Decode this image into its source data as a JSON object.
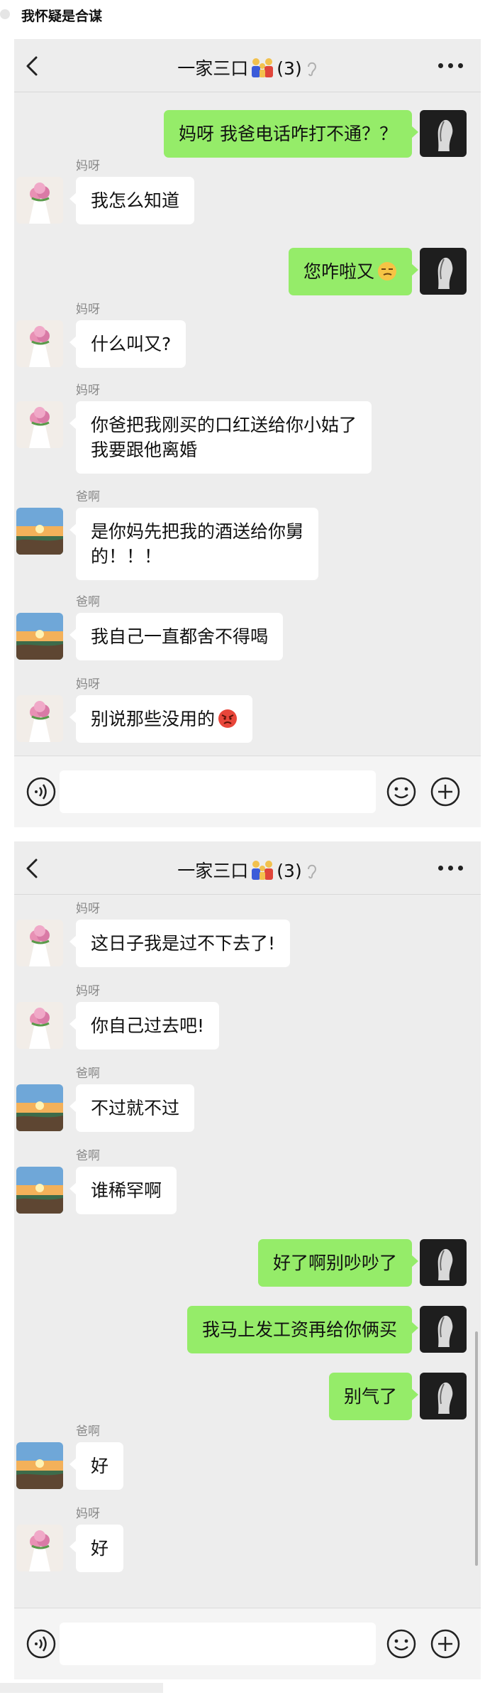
{
  "post": {
    "title": "我怀疑是合谋"
  },
  "chat": {
    "title": "一家三口",
    "member_count": "(3)",
    "title_emoji": "family-emoji",
    "muted_icon": "ear-icon",
    "colors": {
      "background": "#ededed",
      "self_bubble": "#95ec69",
      "other_bubble": "#ffffff",
      "sender_name": "#8a8a8a"
    }
  },
  "screens": [
    {
      "messages": [
        {
          "side": "right",
          "text": "妈呀 我爸电话咋打不通？？"
        },
        {
          "side": "left",
          "sender": "妈呀",
          "text": "我怎么知道"
        },
        {
          "side": "right",
          "text": "您咋啦又",
          "emoji": "smirk-face-icon"
        },
        {
          "side": "left",
          "sender": "妈呀",
          "text": "什么叫又?"
        },
        {
          "side": "left",
          "sender": "妈呀",
          "lines": [
            "你爸把我刚买的口红送给你小姑了",
            " 我要跟他离婚"
          ]
        },
        {
          "side": "left",
          "sender": "爸啊",
          "lines": [
            "是你妈先把我的酒送给你舅",
            "的！！！"
          ]
        },
        {
          "side": "left",
          "sender": "爸啊",
          "text": "我自己一直都舍不得喝"
        },
        {
          "side": "left",
          "sender": "妈呀",
          "text": "别说那些没用的",
          "emoji": "angry-face-icon"
        }
      ]
    },
    {
      "messages": [
        {
          "side": "left",
          "sender": "妈呀",
          "text": "这日子我是过不下去了!"
        },
        {
          "side": "left",
          "sender": "妈呀",
          "text": "你自己过去吧!"
        },
        {
          "side": "left",
          "sender": "爸啊",
          "text": "不过就不过"
        },
        {
          "side": "left",
          "sender": "爸啊",
          "text": "谁稀罕啊"
        },
        {
          "side": "right",
          "text": "好了啊别吵吵了"
        },
        {
          "side": "right",
          "text": "我马上发工资再给你俩买"
        },
        {
          "side": "right",
          "text": "别气了"
        },
        {
          "side": "left",
          "sender": "爸啊",
          "text": "好"
        },
        {
          "side": "left",
          "sender": "妈呀",
          "text": "好"
        }
      ]
    }
  ]
}
